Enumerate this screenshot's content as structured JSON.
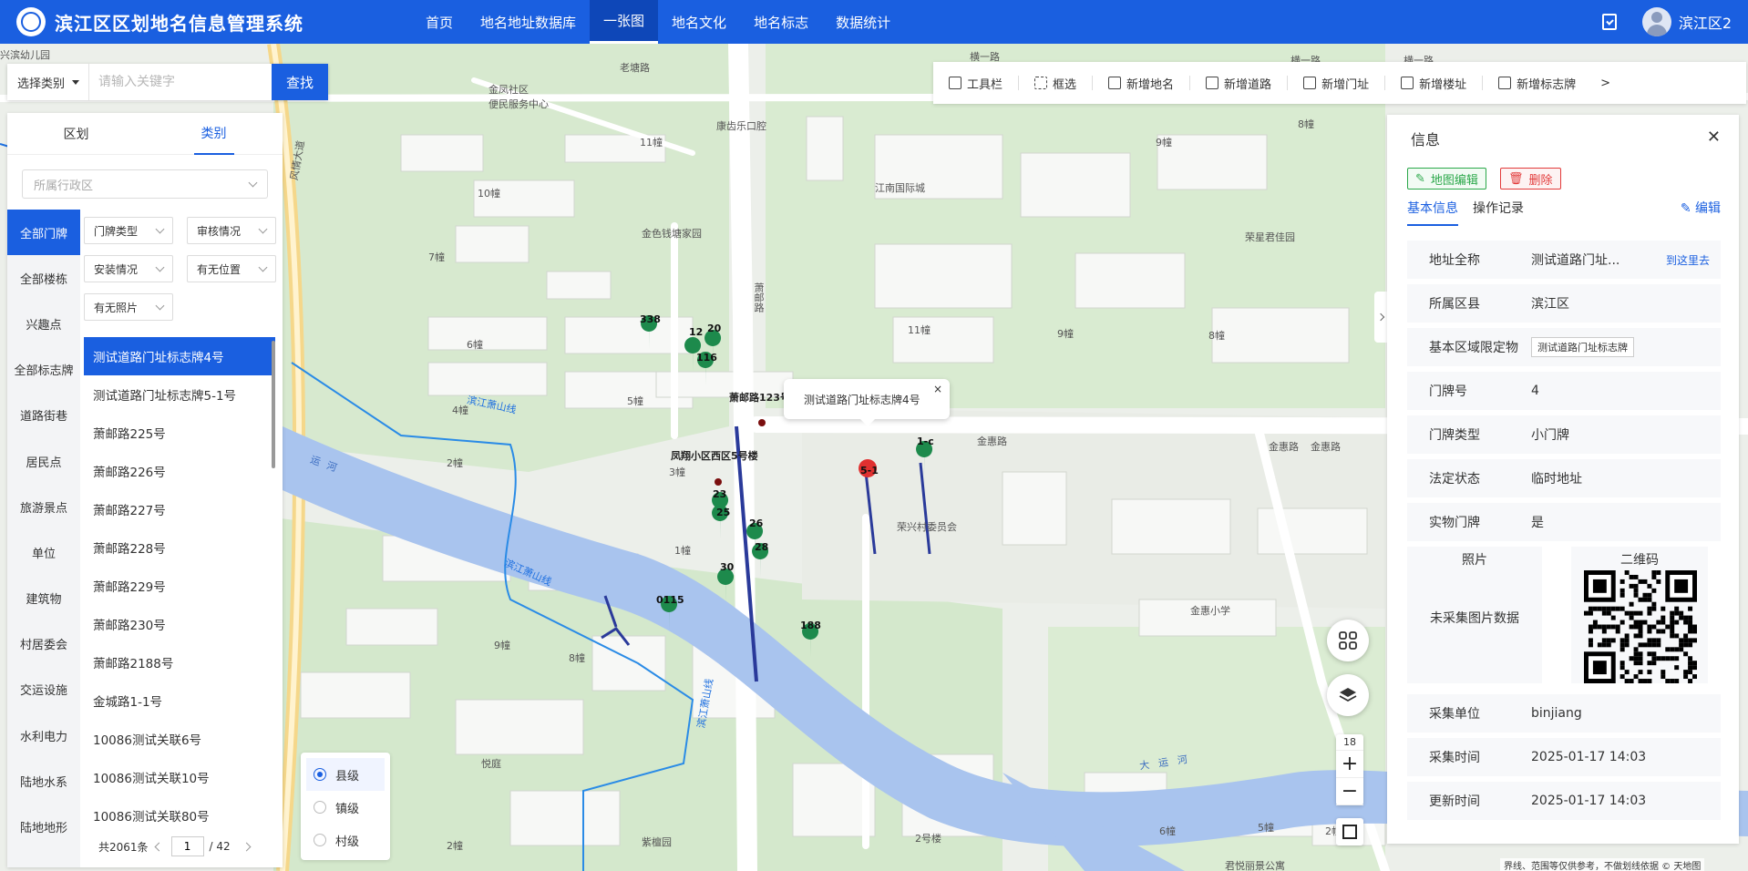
{
  "app": {
    "title": "滨江区区划地名信息管理系统",
    "username": "滨江区2",
    "nav": [
      "首页",
      "地名地址数据库",
      "一张图",
      "地名文化",
      "地名标志",
      "数据统计"
    ],
    "active_nav": "一张图"
  },
  "search": {
    "category_label": "选择类别",
    "placeholder": "请输入关键字",
    "button": "查找"
  },
  "left_panel": {
    "tabs": [
      "区划",
      "类别"
    ],
    "active_tab": "类别",
    "region_placeholder": "所属行政区",
    "categories": [
      "全部门牌",
      "全部楼栋",
      "兴趣点",
      "全部标志牌",
      "道路街巷",
      "居民点",
      "旅游景点",
      "单位",
      "建筑物",
      "村居委会",
      "交运设施",
      "水利电力",
      "陆地水系",
      "陆地地形"
    ],
    "active_category": "全部门牌",
    "filters": [
      "门牌类型",
      "审核情况",
      "安装情况",
      "有无位置",
      "有无照片"
    ],
    "items": [
      "测试道路门址标志牌4号",
      "测试道路门址标志牌5-1号",
      "萧邮路225号",
      "萧邮路226号",
      "萧邮路227号",
      "萧邮路228号",
      "萧邮路229号",
      "萧邮路230号",
      "萧邮路2188号",
      "金城路1-1号",
      "10086测试关联6号",
      "10086测试关联10号",
      "10086测试关联80号"
    ],
    "active_item": "测试道路门址标志牌4号",
    "pager": {
      "total": "共2061条",
      "page": "1",
      "pages": "/ 42"
    }
  },
  "toolbar": {
    "items": [
      "工具栏",
      "框选",
      "新增地名",
      "新增道路",
      "新增门址",
      "新增楼址",
      "新增标志牌"
    ],
    "more": ">"
  },
  "popup": {
    "text": "测试道路门址标志牌4号",
    "close": "×"
  },
  "level_radio": {
    "options": [
      "县级",
      "镇级",
      "村级"
    ],
    "selected": "县级"
  },
  "map": {
    "zoom": "18",
    "zoom_in": "+",
    "zoom_out": "−",
    "labels": [
      "金凤社区",
      "便民服务中心",
      "康齿乐口腔",
      "江南国际城",
      "金色钱塘家园",
      "荣星君佳园",
      "凤翔小区西区5号楼",
      "荣兴村委员会",
      "金惠路",
      "金惠路",
      "金惠路",
      "金惠小学",
      "萧邮路",
      "萧邮路123号",
      "滨江萧山线",
      "滨江萧山线",
      "滨江萧山线",
      "风情大道",
      "老塘路",
      "横一路",
      "横一路",
      "横一路",
      "悦庭",
      "紫檀园",
      "君悦丽景公寓",
      "大运河",
      "运河",
      "11幢",
      "10幢",
      "7幢",
      "6幢",
      "5幢",
      "4幢",
      "2幢",
      "3幢",
      "1幢",
      "9幢",
      "8幢",
      "2幢",
      "11幢",
      "9幢",
      "8幢",
      "9幢",
      "8幢",
      "2号楼",
      "6幢",
      "5幢",
      "2幢",
      "兴滨幼儿园"
    ],
    "markers": [
      "338",
      "12",
      "20",
      "116",
      "23",
      "25",
      "26",
      "28",
      "30",
      "0115",
      "188",
      "5-1",
      "1-c"
    ],
    "copyright": "界线、范围等仅供参考，不做划线依据 © 天地图"
  },
  "info": {
    "title": "信息",
    "close": "✕",
    "btn_edit_map": "地图编辑",
    "btn_delete": "删除",
    "tabs": [
      "基本信息",
      "操作记录"
    ],
    "edit": "编辑",
    "goto": "到这里去",
    "fields": [
      {
        "key": "地址全称",
        "value": "测试道路门址..."
      },
      {
        "key": "所属区县",
        "value": "滨江区"
      },
      {
        "key": "基本区域限定物",
        "value": "测试道路门址标志牌"
      },
      {
        "key": "门牌号",
        "value": "4"
      },
      {
        "key": "门牌类型",
        "value": "小门牌"
      },
      {
        "key": "法定状态",
        "value": "临时地址"
      },
      {
        "key": "实物门牌",
        "value": "是"
      }
    ],
    "photo_label": "照片",
    "photo_empty": "未采集图片数据",
    "qr_label": "二维码",
    "fields2": [
      {
        "key": "采集单位",
        "value": "binjiang"
      },
      {
        "key": "采集时间",
        "value": "2025-01-17 14:03"
      },
      {
        "key": "更新时间",
        "value": "2025-01-17 14:03"
      }
    ]
  },
  "colors": {
    "primary": "#1a5fe0",
    "water": "#a9c4ee",
    "green_area": "#cfe6c8",
    "marker": "#1d8a4c",
    "selected_marker": "#e03030"
  }
}
